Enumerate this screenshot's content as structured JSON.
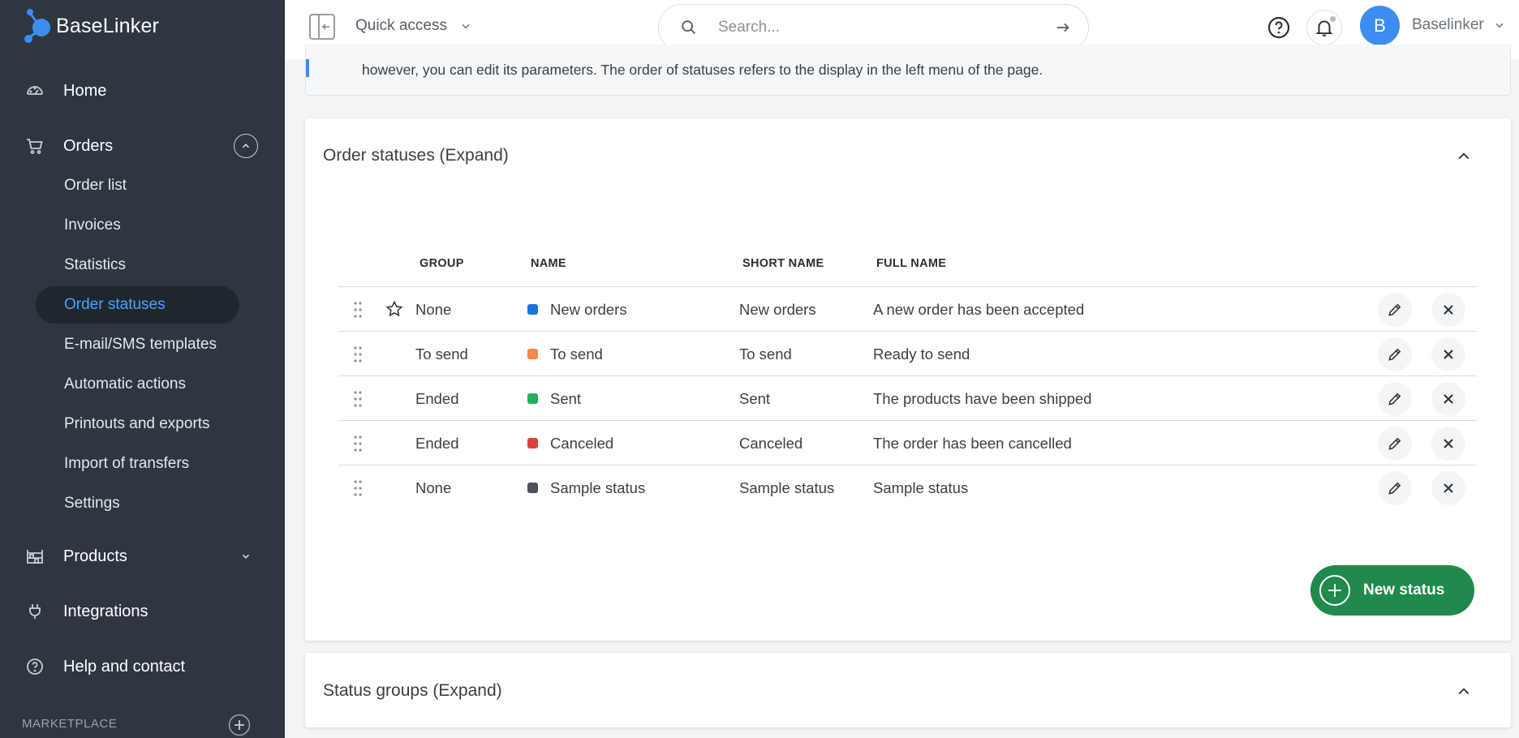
{
  "app": {
    "name": "BaseLinker"
  },
  "sidebar": {
    "home": "Home",
    "orders": "Orders",
    "order_subitems": [
      {
        "label": "Order list"
      },
      {
        "label": "Invoices"
      },
      {
        "label": "Statistics"
      },
      {
        "label": "Order statuses",
        "active": true
      },
      {
        "label": "E-mail/SMS templates"
      },
      {
        "label": "Automatic actions"
      },
      {
        "label": "Printouts and exports"
      },
      {
        "label": "Import of transfers"
      },
      {
        "label": "Settings"
      }
    ],
    "products": "Products",
    "integrations": "Integrations",
    "help": "Help and contact",
    "marketplace": "MARKETPLACE"
  },
  "topbar": {
    "quick_access": "Quick access",
    "search_placeholder": "Search...",
    "avatar_letter": "B",
    "user_name": "Baselinker"
  },
  "info": {
    "text": "however, you can edit its parameters. The order of statuses refers to the display in the left menu of the page."
  },
  "statuses_card": {
    "title": "Order statuses (Expand)",
    "columns": {
      "group": "GROUP",
      "name": "NAME",
      "short_name": "SHORT NAME",
      "full_name": "FULL NAME"
    },
    "rows": [
      {
        "group": "None",
        "name": "New orders",
        "short_name": "New orders",
        "full_name": "A new order has been accepted",
        "color": "#1a73d9",
        "starred": true
      },
      {
        "group": "To send",
        "name": "To send",
        "short_name": "To send",
        "full_name": "Ready to send",
        "color": "#ef8a4b",
        "starred": false
      },
      {
        "group": "Ended",
        "name": "Sent",
        "short_name": "Sent",
        "full_name": "The products have been shipped",
        "color": "#27ae60",
        "starred": false
      },
      {
        "group": "Ended",
        "name": "Canceled",
        "short_name": "Canceled",
        "full_name": "The order has been cancelled",
        "color": "#df3f3a",
        "starred": false
      },
      {
        "group": "None",
        "name": "Sample status",
        "short_name": "Sample status",
        "full_name": "Sample status",
        "color": "#4a5159",
        "starred": false
      }
    ],
    "new_button": "New status"
  },
  "groups_card": {
    "title": "Status groups (Expand)"
  },
  "colors": {
    "sidebar_bg": "#2e3740",
    "accent_blue": "#3d8cf2",
    "active_link": "#4aa3ff",
    "primary_green": "#1f8a4c"
  }
}
